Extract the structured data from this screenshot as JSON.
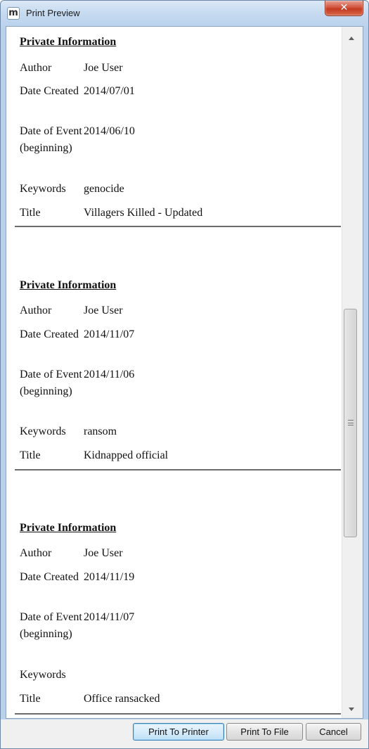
{
  "window": {
    "title": "Print Preview",
    "app_icon_letter": "m",
    "close_glyph": "✕"
  },
  "records": [
    {
      "heading": "Private Information",
      "fields": [
        {
          "label": "Author",
          "value": "Joe User"
        },
        {
          "label": "Date Created",
          "value": "2014/07/01"
        },
        {
          "label": "Date of Event (beginning)",
          "value": "2014/06/10"
        },
        {
          "label": "Keywords",
          "value": "genocide"
        },
        {
          "label": "Title",
          "value": "Villagers Killed - Updated"
        }
      ]
    },
    {
      "heading": "Private Information",
      "fields": [
        {
          "label": "Author",
          "value": "Joe User"
        },
        {
          "label": "Date Created",
          "value": "2014/11/07"
        },
        {
          "label": "Date of Event (beginning)",
          "value": "2014/11/06"
        },
        {
          "label": "Keywords",
          "value": "ransom"
        },
        {
          "label": "Title",
          "value": "Kidnapped official"
        }
      ]
    },
    {
      "heading": "Private Information",
      "fields": [
        {
          "label": "Author",
          "value": "Joe User"
        },
        {
          "label": "Date Created",
          "value": "2014/11/19"
        },
        {
          "label": "Date of Event (beginning)",
          "value": "2014/11/07"
        },
        {
          "label": "Keywords",
          "value": ""
        },
        {
          "label": "Title",
          "value": "Office ransacked"
        }
      ]
    }
  ],
  "buttons": {
    "print_to_printer": "Print To Printer",
    "print_to_file": "Print To File",
    "cancel": "Cancel"
  },
  "icons": {
    "scroll_up": "scroll-up-arrow-icon",
    "scroll_down": "scroll-down-arrow-icon",
    "grip": "scroll-grip-icon"
  },
  "colors": {
    "titlebar": "#c6daf0",
    "close_button": "#c23a20",
    "default_button_border": "#3c7fb1"
  }
}
